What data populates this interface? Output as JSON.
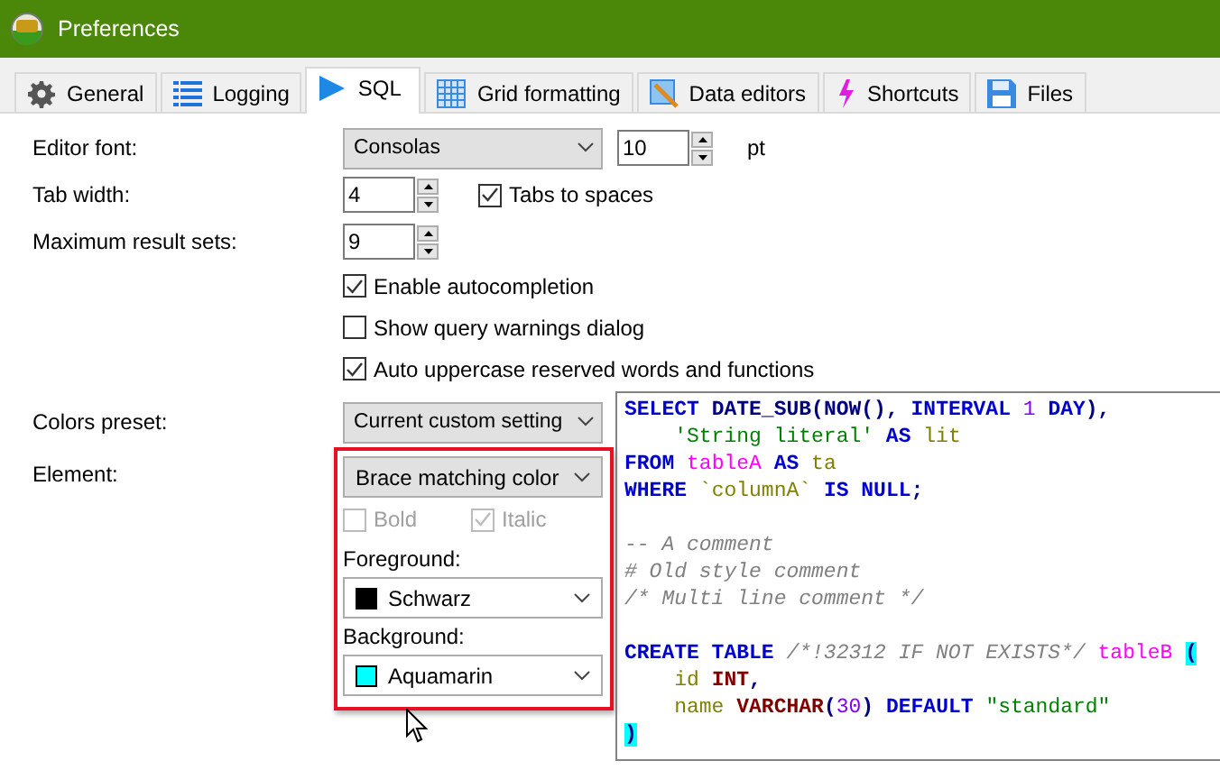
{
  "window": {
    "title": "Preferences"
  },
  "tabs": [
    {
      "label": "General",
      "selected": false
    },
    {
      "label": "Logging",
      "selected": false
    },
    {
      "label": "SQL",
      "selected": true
    },
    {
      "label": "Grid formatting",
      "selected": false
    },
    {
      "label": "Data editors",
      "selected": false
    },
    {
      "label": "Shortcuts",
      "selected": false
    },
    {
      "label": "Files",
      "selected": false
    }
  ],
  "editor_font": {
    "label": "Editor font:",
    "value": "Consolas",
    "size": "10",
    "unit": "pt"
  },
  "tab_width": {
    "label": "Tab width:",
    "value": "4",
    "option": {
      "label": "Tabs to spaces",
      "checked": true
    }
  },
  "max_result_sets": {
    "label": "Maximum result sets:",
    "value": "9"
  },
  "options": [
    {
      "label": "Enable autocompletion",
      "checked": true
    },
    {
      "label": "Show query warnings dialog",
      "checked": false
    },
    {
      "label": "Auto uppercase reserved words and functions",
      "checked": true
    }
  ],
  "colors_preset": {
    "label": "Colors preset:",
    "value": "Current custom setting"
  },
  "element": {
    "label": "Element:",
    "value": "Brace matching color",
    "bold": {
      "label": "Bold",
      "checked": false,
      "disabled": true
    },
    "italic": {
      "label": "Italic",
      "checked": true,
      "disabled": true
    },
    "foreground": {
      "label": "Foreground:",
      "value": "Schwarz",
      "color": "#000000"
    },
    "background": {
      "label": "Background:",
      "value": "Aquamarin",
      "color": "#00ffff"
    }
  },
  "preview_blocks": [
    [
      [
        {
          "text": "SELECT ",
          "kind": "keyword"
        },
        {
          "text": "DATE_SUB",
          "kind": "function"
        },
        {
          "text": "(",
          "kind": "symbol"
        },
        {
          "text": "NOW",
          "kind": "function"
        },
        {
          "text": "(), ",
          "kind": "symbol"
        },
        {
          "text": "INTERVAL ",
          "kind": "keyword"
        },
        {
          "text": "1",
          "kind": "number"
        },
        {
          "text": " DAY",
          "kind": "keyword"
        },
        {
          "text": "),",
          "kind": "symbol"
        }
      ],
      [
        {
          "text": "    'String literal'",
          "kind": "string"
        },
        {
          "text": " AS ",
          "kind": "keyword"
        },
        {
          "text": "lit",
          "kind": "identifier"
        }
      ],
      [
        {
          "text": "FROM ",
          "kind": "keyword"
        },
        {
          "text": "tableA",
          "kind": "table"
        },
        {
          "text": " AS ",
          "kind": "keyword"
        },
        {
          "text": "ta",
          "kind": "identifier"
        }
      ],
      [
        {
          "text": "WHERE ",
          "kind": "keyword"
        },
        {
          "text": "`columnA`",
          "kind": "identifier"
        },
        {
          "text": " IS NULL",
          "kind": "keyword"
        },
        {
          "text": ";",
          "kind": "symbol"
        }
      ]
    ],
    [
      [
        {
          "text": "-- A comment",
          "kind": "comment"
        }
      ],
      [
        {
          "text": "# Old style comment",
          "kind": "comment"
        }
      ],
      [
        {
          "text": "/* Multi line comment */",
          "kind": "comment"
        }
      ]
    ],
    [
      [
        {
          "text": "CREATE TABLE ",
          "kind": "keyword"
        },
        {
          "text": "/*!32312 IF NOT EXISTS*/",
          "kind": "comment"
        },
        {
          "text": " tableB ",
          "kind": "table"
        },
        {
          "text": "(",
          "kind": "brace"
        }
      ],
      [
        {
          "text": "    id ",
          "kind": "identifier"
        },
        {
          "text": "INT",
          "kind": "type"
        },
        {
          "text": ",",
          "kind": "symbol"
        }
      ],
      [
        {
          "text": "    name ",
          "kind": "identifier"
        },
        {
          "text": "VARCHAR",
          "kind": "type"
        },
        {
          "text": "(",
          "kind": "symbol"
        },
        {
          "text": "30",
          "kind": "number"
        },
        {
          "text": ") ",
          "kind": "symbol"
        },
        {
          "text": "DEFAULT ",
          "kind": "keyword"
        },
        {
          "text": "\"standard\"",
          "kind": "string"
        }
      ],
      [
        {
          "text": ")",
          "kind": "brace"
        }
      ]
    ]
  ]
}
